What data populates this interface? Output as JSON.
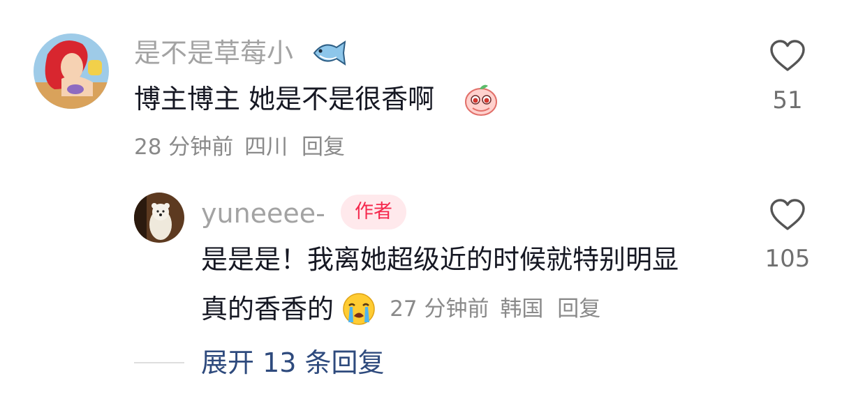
{
  "comment": {
    "username": "是不是草莓小",
    "username_emoji_icon": "fish-icon",
    "text": "博主博主 她是不是很香啊",
    "text_emoji_icon": "pleading-peach-icon",
    "time": "28 分钟前",
    "location": "四川",
    "reply_label": "回复",
    "like_count": "51"
  },
  "reply": {
    "username": "yuneeee-",
    "author_badge": "作者",
    "text_line1": "是是是！我离她超级近的时候就特别明显",
    "text_line2": "真的香香的",
    "text_emoji_icon": "crying-face-icon",
    "time": "27 分钟前",
    "location": "韩国",
    "reply_label": "回复",
    "like_count": "105"
  },
  "expand_label": "展开 13 条回复"
}
